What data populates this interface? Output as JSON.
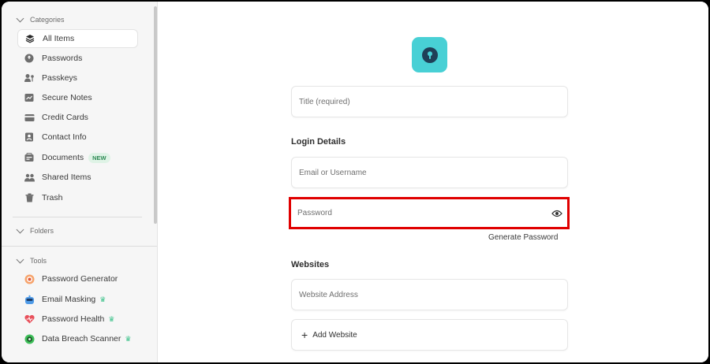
{
  "sidebar": {
    "categories_header": "Categories",
    "categories": [
      {
        "label": "All Items",
        "icon": "layers-icon",
        "active": true
      },
      {
        "label": "Passwords",
        "icon": "password-icon"
      },
      {
        "label": "Passkeys",
        "icon": "passkey-icon"
      },
      {
        "label": "Secure Notes",
        "icon": "note-icon"
      },
      {
        "label": "Credit Cards",
        "icon": "credit-card-icon"
      },
      {
        "label": "Contact Info",
        "icon": "contact-icon"
      },
      {
        "label": "Documents",
        "icon": "document-icon",
        "badge": "NEW"
      },
      {
        "label": "Shared Items",
        "icon": "shared-icon"
      },
      {
        "label": "Trash",
        "icon": "trash-icon"
      }
    ],
    "folders_header": "Folders",
    "tools_header": "Tools",
    "tools": [
      {
        "label": "Password Generator",
        "icon": "password-generator-icon"
      },
      {
        "label": "Email Masking",
        "icon": "email-masking-icon"
      },
      {
        "label": "Password Health",
        "icon": "password-health-icon"
      },
      {
        "label": "Data Breach Scanner",
        "icon": "breach-scanner-icon"
      }
    ]
  },
  "form": {
    "title_placeholder": "Title (required)",
    "login_details_label": "Login Details",
    "email_placeholder": "Email or Username",
    "password_placeholder": "Password",
    "generate_password_label": "Generate Password",
    "websites_label": "Websites",
    "website_placeholder": "Website Address",
    "add_website_label": "Add Website"
  },
  "colors": {
    "accent": "#48d0d5",
    "highlight": "#e00000",
    "badge_bg": "#dff3e6",
    "crown": "#3cc28a"
  }
}
